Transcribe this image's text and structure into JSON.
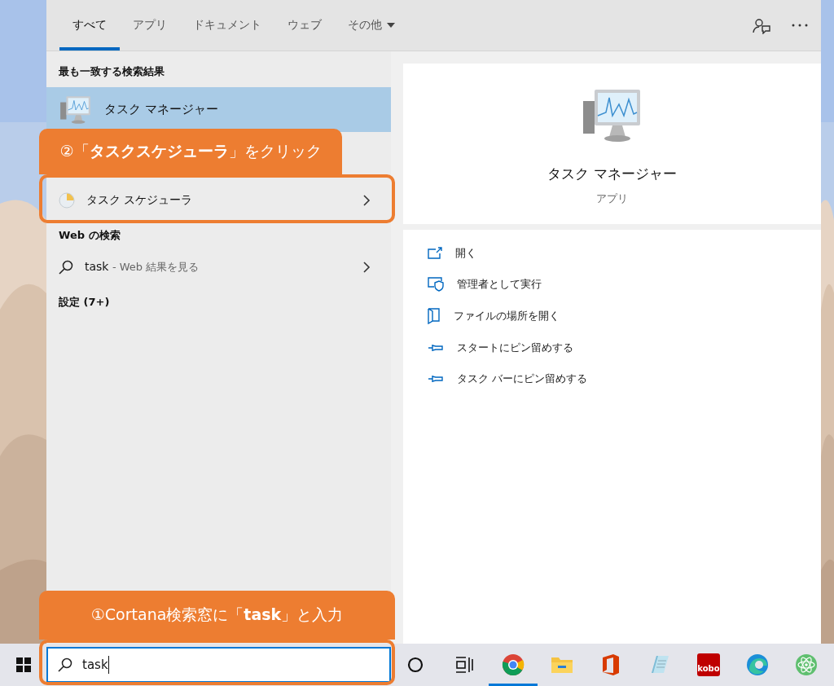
{
  "tabs": [
    {
      "label": "すべて",
      "selected": true,
      "kind": "plain"
    },
    {
      "label": "アプリ",
      "selected": false,
      "kind": "plain"
    },
    {
      "label": "ドキュメント",
      "selected": false,
      "kind": "plain"
    },
    {
      "label": "ウェブ",
      "selected": false,
      "kind": "plain"
    },
    {
      "label": "その他",
      "selected": false,
      "kind": "dropdown"
    }
  ],
  "results": {
    "best_match_heading": "最も一致する検索結果",
    "best_match": {
      "title": "タスク マネージャー",
      "selected": true
    },
    "apps": [
      {
        "title": "タスク スケジューラ",
        "selected": false
      }
    ],
    "web_heading": "Web の検索",
    "web": [
      {
        "query": "task",
        "hint": "- Web 結果を見る"
      }
    ],
    "settings_heading": "設定 (7+)"
  },
  "preview": {
    "title": "タスク マネージャー",
    "subtitle": "アプリ",
    "actions": [
      {
        "label": "開く",
        "kind": "open"
      },
      {
        "label": "管理者として実行",
        "kind": "admin"
      },
      {
        "label": "ファイルの場所を開く",
        "kind": "folder"
      },
      {
        "label": "スタートにピン留めする",
        "kind": "pin"
      },
      {
        "label": "タスク バーにピン留めする",
        "kind": "pin"
      }
    ]
  },
  "callouts": [
    {
      "text": "②「**タスクスケジューラ**」をクリック"
    },
    {
      "text": "①Cortana検索窓に「**task**」と入力"
    }
  ],
  "taskbar": {
    "search": {
      "value": "task"
    },
    "apps": [
      {
        "kind": "chrome",
        "selected": true
      },
      {
        "kind": "explorer",
        "selected": false
      },
      {
        "kind": "office",
        "selected": false
      },
      {
        "kind": "notepad",
        "selected": false
      },
      {
        "kind": "kobo",
        "label": "kobo",
        "selected": false
      },
      {
        "kind": "edge",
        "selected": false
      },
      {
        "kind": "atom",
        "selected": false
      }
    ]
  }
}
